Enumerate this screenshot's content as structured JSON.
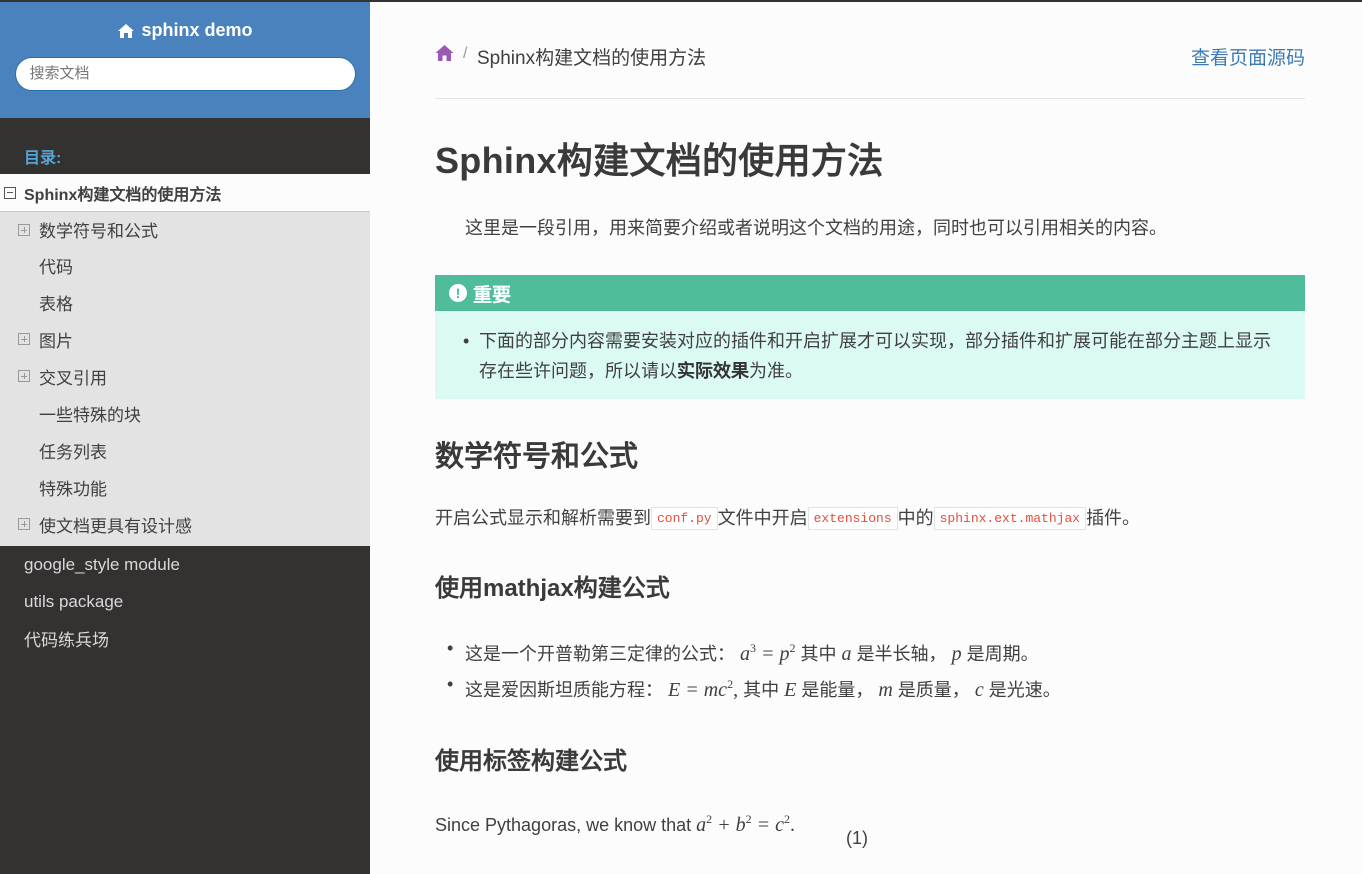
{
  "sidebar": {
    "project_title": "sphinx demo",
    "search_placeholder": "搜索文档",
    "caption": "目录:",
    "current_page": "Sphinx构建文档的使用方法",
    "sub_items": [
      {
        "label": "数学符号和公式",
        "expandable": true
      },
      {
        "label": "代码",
        "expandable": false
      },
      {
        "label": "表格",
        "expandable": false
      },
      {
        "label": "图片",
        "expandable": true
      },
      {
        "label": "交叉引用",
        "expandable": true
      },
      {
        "label": "一些特殊的块",
        "expandable": false
      },
      {
        "label": "任务列表",
        "expandable": false
      },
      {
        "label": "特殊功能",
        "expandable": false
      },
      {
        "label": "使文档更具有设计感",
        "expandable": true
      }
    ],
    "top_items": [
      "google_style module",
      "utils package",
      "代码练兵场"
    ]
  },
  "breadcrumb": {
    "current": "Sphinx构建文档的使用方法",
    "separator": "/",
    "view_source": "查看页面源码"
  },
  "content": {
    "title": "Sphinx构建文档的使用方法",
    "quote": "这里是一段引用，用来简要介绍或者说明这个文档的用途，同时也可以引用相关的内容。",
    "admonition": {
      "title": "重要",
      "text_before": "下面的部分内容需要安装对应的插件和开启扩展才可以实现，部分插件和扩展可能在部分主题上显示存在些许问题，所以请以",
      "bold": "实际效果",
      "text_after": "为准。"
    },
    "section_math": {
      "heading": "数学符号和公式",
      "p_part1": "开启公式显示和解析需要到",
      "code1": "conf.py",
      "p_part2": "文件中开启",
      "code2": "extensions",
      "p_part3": "中的",
      "code3": "sphinx.ext.mathjax",
      "p_part4": "插件。"
    },
    "sub_mathjax": {
      "heading": "使用mathjax构建公式",
      "item1_lead": "这是一个开普勒第三定律的公式：",
      "item1_mid": "其中",
      "item1_a_text": "是半长轴，",
      "item1_p_text": "是周期。",
      "item2_lead": "这是爱因斯坦质能方程：",
      "item2_mid": "其中",
      "item2_e_text": "是能量，",
      "item2_m_text": "是质量，",
      "item2_c_text": "是光速。"
    },
    "sub_tags": {
      "heading": "使用标签构建公式",
      "text": "Since Pythagoras, we know that"
    },
    "equation_number": "(1)"
  },
  "colors": {
    "sidebar_header": "#4a82bd",
    "sidebar_bg": "#343131",
    "link": "#3b7bb5",
    "admonition_title": "#4fbc9b",
    "admonition_bg": "#dbfaf4",
    "code_text": "#e74c3c"
  },
  "icons": [
    "home-icon",
    "exclamation-circle-icon",
    "toggle-minus-icon",
    "toggle-plus-icon"
  ]
}
